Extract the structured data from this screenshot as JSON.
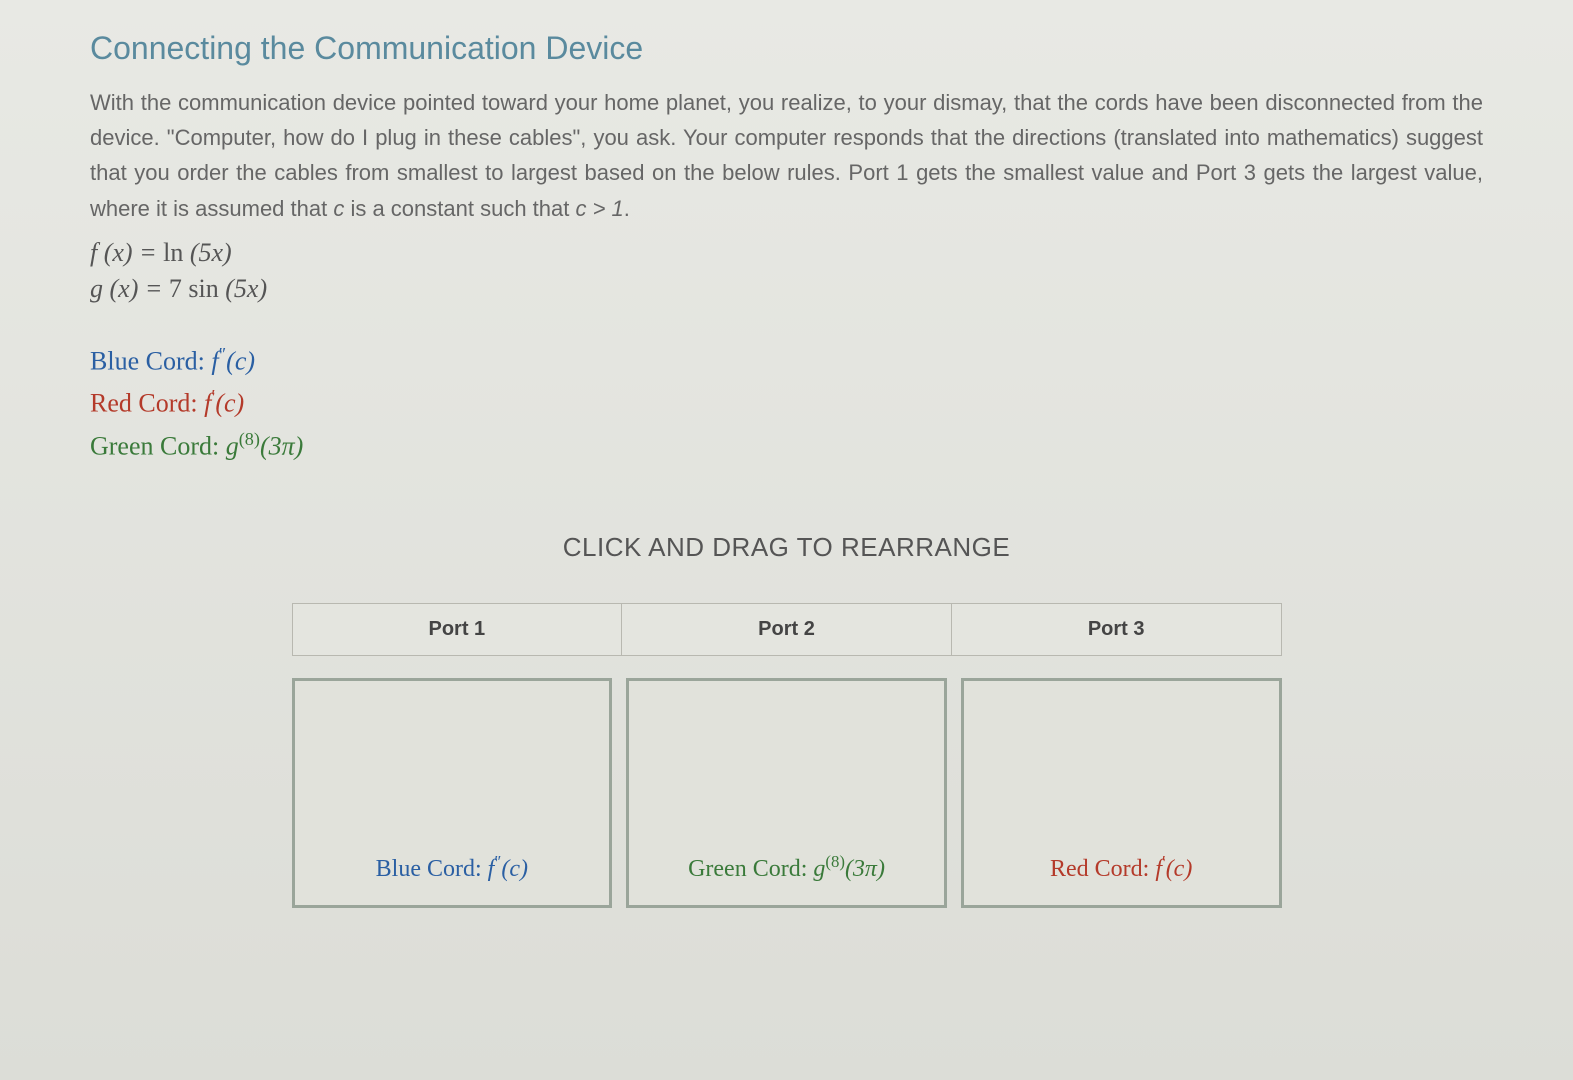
{
  "title": "Connecting the Communication Device",
  "paragraph_part1": "With the communication device pointed toward your home planet, you realize, to your dismay, that the cords have been disconnected from the device. \"Computer, how do I plug in these cables\", you ask. Your computer responds that the directions (translated into mathematics) suggest that you order the cables from smallest to largest based on the below rules. Port 1 gets the smallest value and Port 3 gets the largest value, where it is assumed that ",
  "paragraph_const1": "c",
  "paragraph_part2": " is a constant such that ",
  "paragraph_const2": "c > 1",
  "paragraph_part3": ".",
  "functions": {
    "f_lhs": "f (x) = ",
    "f_rhs_op": "ln ",
    "f_rhs_arg": "(5x)",
    "g_lhs": "g (x) = ",
    "g_rhs_coef": "7 ",
    "g_rhs_op": "sin ",
    "g_rhs_arg": "(5x)"
  },
  "cords": {
    "blue_label": "Blue Cord: ",
    "blue_expr_fn": "f",
    "blue_expr_sup": "″",
    "blue_expr_arg": "(c)",
    "red_label": "Red Cord: ",
    "red_expr_fn": "f",
    "red_expr_sup": "′",
    "red_expr_arg": "(c)",
    "green_label": "Green Cord: ",
    "green_expr_fn": "g",
    "green_expr_sup": "(8)",
    "green_expr_arg": "(3π)"
  },
  "instruction": "CLICK AND DRAG TO REARRANGE",
  "ports": [
    "Port 1",
    "Port 2",
    "Port 3"
  ],
  "cards": {
    "card1_label": "Blue Cord: ",
    "card1_fn": "f",
    "card1_sup": "″",
    "card1_arg": "(c)",
    "card2_label": "Green Cord: ",
    "card2_fn": "g",
    "card2_sup": "(8)",
    "card2_arg": "(3π)",
    "card3_label": "Red Cord: ",
    "card3_fn": "f",
    "card3_sup": "′",
    "card3_arg": "(c)"
  }
}
